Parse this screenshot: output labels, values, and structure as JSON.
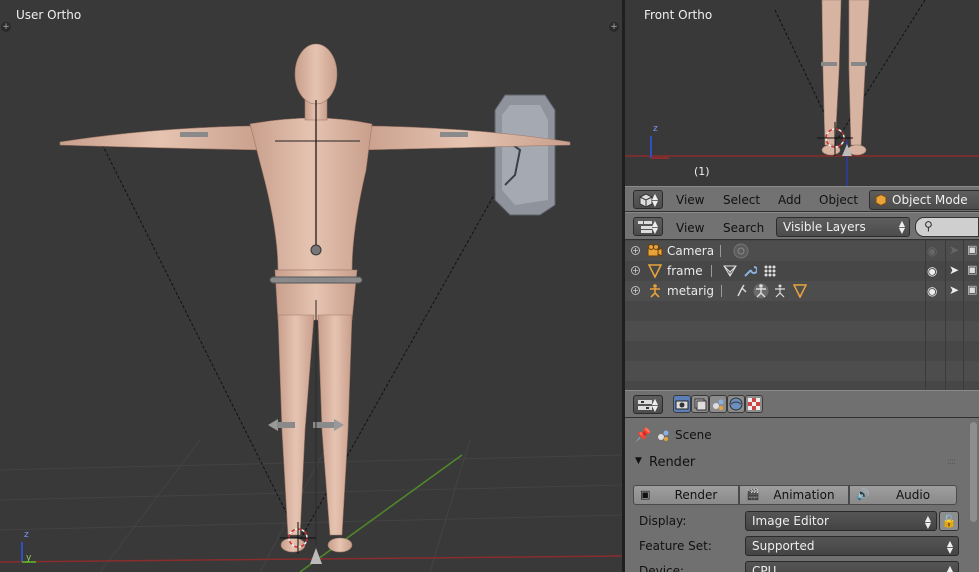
{
  "main_view": {
    "label": "User Ortho",
    "axis_x": "y",
    "axis_z": "z"
  },
  "front_view": {
    "label": "Front Ortho",
    "frame": "(1)",
    "axis_z": "z"
  },
  "view3d_header": {
    "menus": [
      "View",
      "Select",
      "Add",
      "Object"
    ],
    "mode": "Object Mode"
  },
  "outliner_header": {
    "menus": [
      "View",
      "Search"
    ],
    "filter": "Visible Layers",
    "search_placeholder": ""
  },
  "outliner": {
    "items": [
      {
        "name": "Camera",
        "icon": "camera-icon"
      },
      {
        "name": "frame",
        "icon": "mesh-icon"
      },
      {
        "name": "metarig",
        "icon": "armature-icon"
      }
    ]
  },
  "properties": {
    "context": "Scene",
    "panel": "Render",
    "buttons": [
      "Render",
      "Animation",
      "Audio"
    ],
    "fields": [
      {
        "label": "Display:",
        "value": "Image Editor"
      },
      {
        "label": "Feature Set:",
        "value": "Supported"
      },
      {
        "label": "Device:",
        "value": "CPU"
      }
    ]
  },
  "colors": {
    "accent": "#5b7fb8",
    "viewport_bg": "#393939",
    "header_bg": "#727272",
    "x_axis": "#9a2a2a",
    "y_axis": "#5a9a2a"
  }
}
